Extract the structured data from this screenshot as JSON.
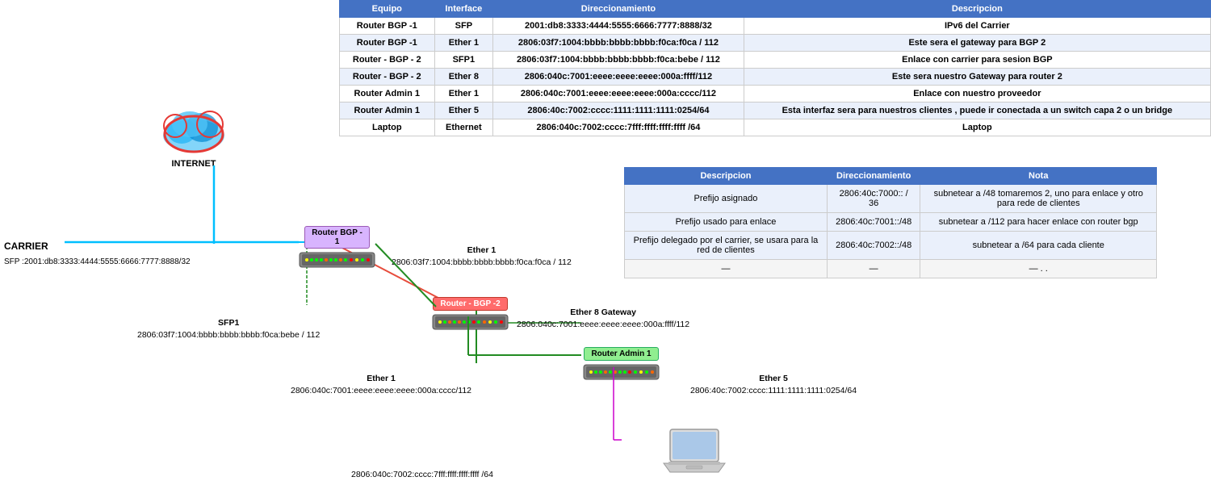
{
  "table": {
    "headers": [
      "Equipo",
      "Interface",
      "Direccionamiento",
      "Descripcion"
    ],
    "rows": [
      {
        "equipo": "Router BGP -1",
        "interface": "SFP",
        "direccionamiento": "2001:db8:3333:4444:5555:6666:7777:8888/32",
        "descripcion": "IPv6 del Carrier"
      },
      {
        "equipo": "Router BGP -1",
        "interface": "Ether 1",
        "direccionamiento": "2806:03f7:1004:bbbb:bbbb:bbbb:f0ca:f0ca / 112",
        "descripcion": "Este sera el gateway para BGP 2"
      },
      {
        "equipo": "Router - BGP - 2",
        "interface": "SFP1",
        "direccionamiento": "2806:03f7:1004:bbbb:bbbb:bbbb:f0ca:bebe / 112",
        "descripcion": "Enlace con carrier para sesion BGP"
      },
      {
        "equipo": "Router - BGP - 2",
        "interface": "Ether 8",
        "direccionamiento": "2806:040c:7001:eeee:eeee:eeee:000a:ffff/112",
        "descripcion": "Este sera nuestro Gateway para router 2"
      },
      {
        "equipo": "Router Admin 1",
        "interface": "Ether 1",
        "direccionamiento": "2806:040c:7001:eeee:eeee:eeee:000a:cccc/112",
        "descripcion": "Enlace con nuestro proveedor"
      },
      {
        "equipo": "Router Admin 1",
        "interface": "Ether 5",
        "direccionamiento": "2806:40c:7002:cccc:1111:1111:1111:0254/64",
        "descripcion": "Esta interfaz sera para nuestros clientes , puede ir conectada a un switch capa 2 o un bridge"
      },
      {
        "equipo": "Laptop",
        "interface": "Ethernet",
        "direccionamiento": "2806:040c:7002:cccc:7fff:ffff:ffff:ffff /64",
        "descripcion": "Laptop"
      }
    ]
  },
  "second_table": {
    "headers": [
      "Descripcion",
      "Direccionamiento",
      "Nota"
    ],
    "rows": [
      {
        "descripcion": "Prefijo asignado",
        "direccionamiento": "2806:40c:7000:: / 36",
        "nota": "subnetear a /48  tomaremos 2, uno para enlace y otro para rede de clientes"
      },
      {
        "descripcion": "Prefijo usado para enlace",
        "direccionamiento": "2806:40c:7001::/48",
        "nota": "subnetear a /112 para hacer enlace con router bgp"
      },
      {
        "descripcion": "Prefijo delegado por el carrier, se usara para la red de clientes",
        "direccionamiento": "2806:40c:7002::/48",
        "nota": "subnetear a /64 para cada cliente"
      },
      {
        "descripcion": "—",
        "direccionamiento": "—",
        "nota": "— . ."
      }
    ]
  },
  "diagram": {
    "internet_label": "INTERNET",
    "carrier_label": "CARRIER",
    "carrier_address": "SFP :2001:db8:3333:4444:5555:6666:7777:8888/32",
    "router_bgp1_label": "Router BGP -\n1",
    "router_bgp2_label": "Router - BGP -2",
    "router_admin1_label": "Router Admin 1",
    "ether1_label": "Ether 1",
    "ether1_addr": "2806:03f7:1004:bbbb:bbbb:bbbb:f0ca:f0ca / 112",
    "sfp1_label": "SFP1",
    "sfp1_addr": "2806:03f7:1004:bbbb:bbbb:bbbb:f0ca:bebe / 112",
    "ether1b_label": "Ether 1",
    "ether1b_addr": "2806:040c:7001:eeee:eeee:eeee:000a:cccc/112",
    "ether8_label": "Ether 8 Gateway",
    "ether8_addr": "2806:040c:7001:eeee:eeee:eeee:000a:ffff/112",
    "ether5_label": "Ether 5",
    "ether5_addr": "2806:40c:7002:cccc:1111:1111:1111:0254/64",
    "laptop_addr": "2806:040c:7002:cccc:7fff:ffff:ffff:ffff /64",
    "laptop_label": "Laptop"
  },
  "colors": {
    "header_bg": "#4472C4",
    "table_even": "#EAF0FB",
    "router_bgp1_bg": "#D8B4FE",
    "router_bgp2_bg": "#FF6B6B",
    "router_admin_bg": "#90EE90",
    "line_color": "#666",
    "cyan_line": "#00BFFF",
    "magenta_line": "#FF00FF",
    "green_line": "#228B22"
  }
}
